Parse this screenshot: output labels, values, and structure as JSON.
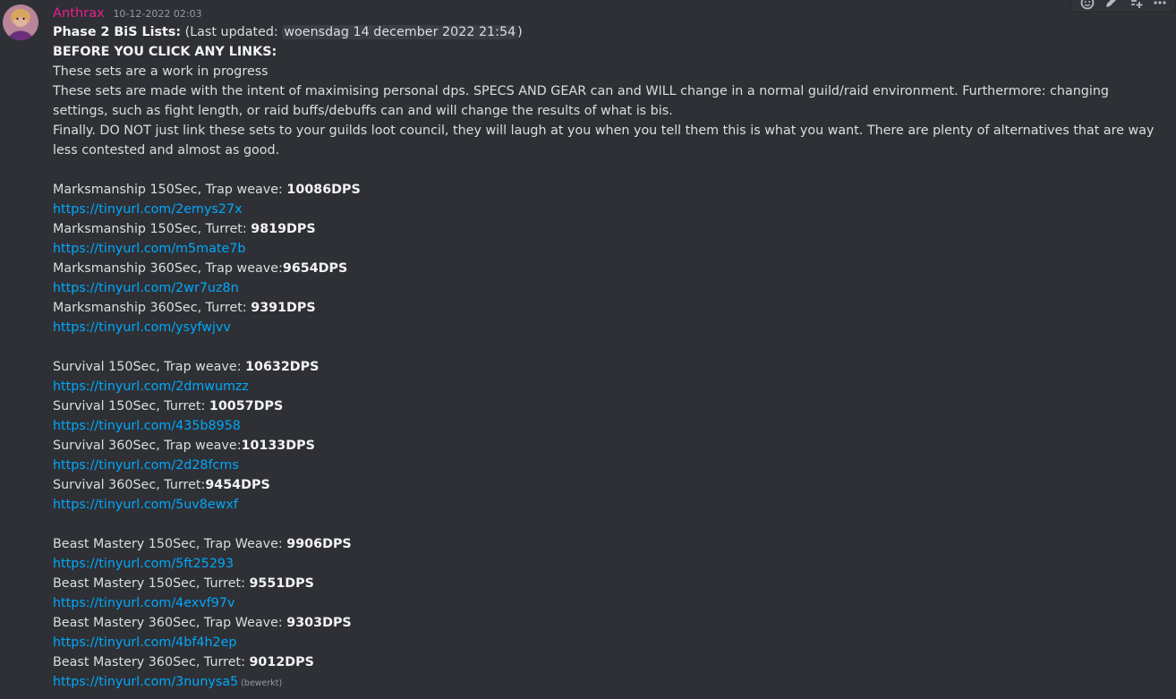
{
  "message": {
    "username": "Anthrax",
    "timestamp": "10-12-2022 02:03",
    "title_bold": "Phase 2 BiS Lists:",
    "last_updated_label": "(Last updated: ",
    "last_updated_value": "woensdag 14 december 2022 21:54",
    "last_updated_close": ")",
    "warning_heading": "BEFORE YOU CLICK ANY LINKS:",
    "line_wip": "These sets are a work in progress",
    "para_intent": "These sets are made with the intent of maximising personal dps. SPECS AND GEAR can and WILL change in a normal guild/raid environment. Furthermore: changing settings, such as fight length, or raid buffs/debuffs can and will change the results of what is bis.",
    "para_finally": "Finally. DO NOT just link these sets to your guilds loot council, they will laugh at you when you tell them this is what you want. There are plenty of alternatives that are way less contested and almost as good.",
    "edited_label": "(bewerkt)"
  },
  "groups": [
    {
      "entries": [
        {
          "label": "Marksmanship 150Sec, Trap weave: ",
          "dps": "10086DPS",
          "url": "https://tinyurl.com/2emys27x"
        },
        {
          "label": "Marksmanship 150Sec, Turret: ",
          "dps": "9819DPS",
          "url": "https://tinyurl.com/m5mate7b"
        },
        {
          "label": "Marksmanship 360Sec, Trap weave:",
          "dps": "9654DPS",
          "url": "https://tinyurl.com/2wr7uz8n"
        },
        {
          "label": "Marksmanship 360Sec, Turret: ",
          "dps": "9391DPS",
          "url": "https://tinyurl.com/ysyfwjvv"
        }
      ]
    },
    {
      "entries": [
        {
          "label": "Survival 150Sec, Trap weave: ",
          "dps": "10632DPS",
          "url": "https://tinyurl.com/2dmwumzz"
        },
        {
          "label": "Survival 150Sec, Turret: ",
          "dps": "10057DPS",
          "url": "https://tinyurl.com/435b8958"
        },
        {
          "label": "Survival 360Sec, Trap weave:",
          "dps": "10133DPS",
          "url": "https://tinyurl.com/2d28fcms"
        },
        {
          "label": "Survival 360Sec, Turret:",
          "dps": "9454DPS",
          "url": "https://tinyurl.com/5uv8ewxf"
        }
      ]
    },
    {
      "entries": [
        {
          "label": "Beast Mastery 150Sec, Trap Weave: ",
          "dps": "9906DPS",
          "url": "https://tinyurl.com/5ft25293"
        },
        {
          "label": "Beast Mastery 150Sec, Turret: ",
          "dps": "9551DPS",
          "url": "https://tinyurl.com/4exvf97v"
        },
        {
          "label": "Beast Mastery 360Sec, Trap Weave: ",
          "dps": "9303DPS",
          "url": "https://tinyurl.com/4bf4h2ep"
        },
        {
          "label": "Beast Mastery 360Sec, Turret: ",
          "dps": "9012DPS",
          "url": "https://tinyurl.com/3nunysa5"
        }
      ]
    }
  ],
  "toolbar": {
    "icons": [
      "add-reaction-icon",
      "edit-icon",
      "create-thread-icon",
      "more-options-icon"
    ]
  },
  "colors": {
    "background": "#2e3035",
    "username": "#e91e8c",
    "link": "#00a8fc",
    "text": "#dbdee1",
    "muted": "#949ba4"
  }
}
